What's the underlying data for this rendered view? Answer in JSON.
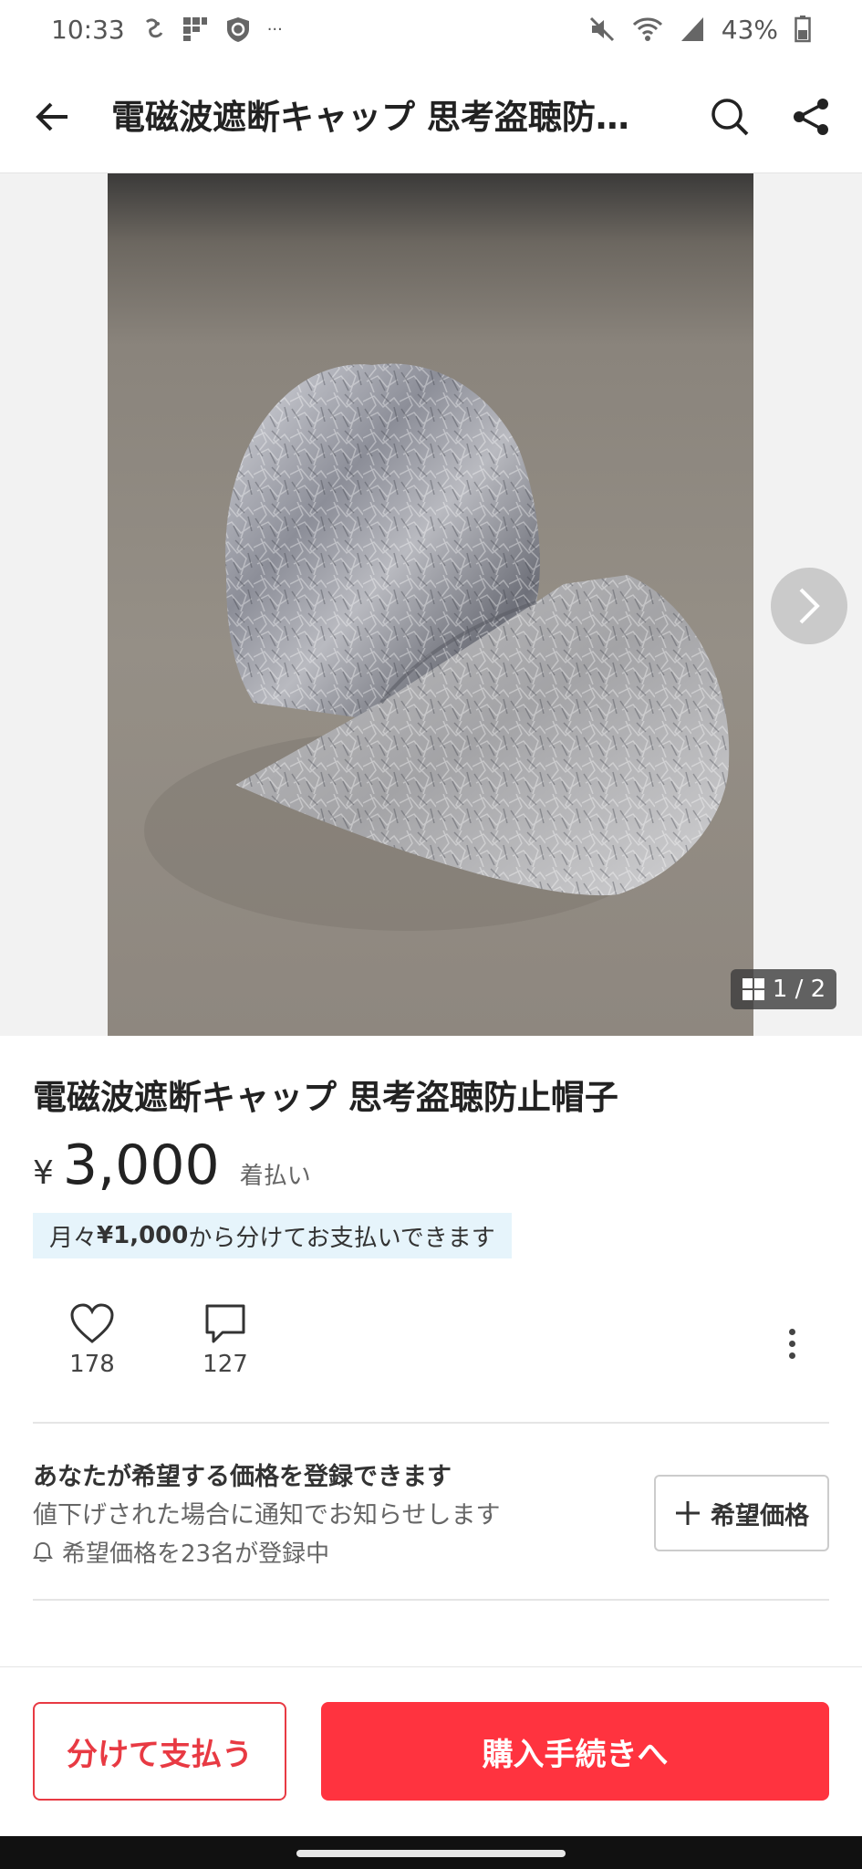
{
  "status_bar": {
    "time": "10:33",
    "overflow": "···",
    "battery": "43%",
    "icons": [
      "notification-app-icon",
      "grid-app-icon",
      "shield-app-icon",
      "mute-icon",
      "wifi-icon",
      "signal-icon",
      "battery-icon"
    ]
  },
  "header": {
    "title": "電磁波遮断キャップ 思考盗聴防止帽子",
    "icons": [
      "back-arrow-icon",
      "search-icon",
      "share-icon"
    ]
  },
  "gallery": {
    "counter": "1 / 2",
    "current_index": 1,
    "total": 2,
    "icons": [
      "chevron-right-icon",
      "grid-icon"
    ]
  },
  "product": {
    "title": "電磁波遮断キャップ 思考盗聴防止帽子",
    "currency_symbol": "¥",
    "price": "3,000",
    "shipping": "着払い",
    "installment_prefix": "月々",
    "installment_amount": "¥1,000",
    "installment_suffix": "から分けてお支払いできます"
  },
  "actions": {
    "likes": "178",
    "comments": "127",
    "icons": [
      "heart-icon",
      "comment-icon",
      "more-vertical-icon"
    ]
  },
  "wish_price": {
    "title": "あなたが希望する価格を登録できます",
    "description": "値下げされた場合に通知でお知らせします",
    "registered": "希望価格を23名が登録中",
    "button_label": "希望価格",
    "icons": [
      "bell-icon",
      "plus-icon"
    ]
  },
  "bottom_bar": {
    "split_pay_label": "分けて支払う",
    "buy_label": "購入手続きへ"
  },
  "colors": {
    "accent": "#ff333f",
    "installment_bg": "#e6f4fb"
  }
}
